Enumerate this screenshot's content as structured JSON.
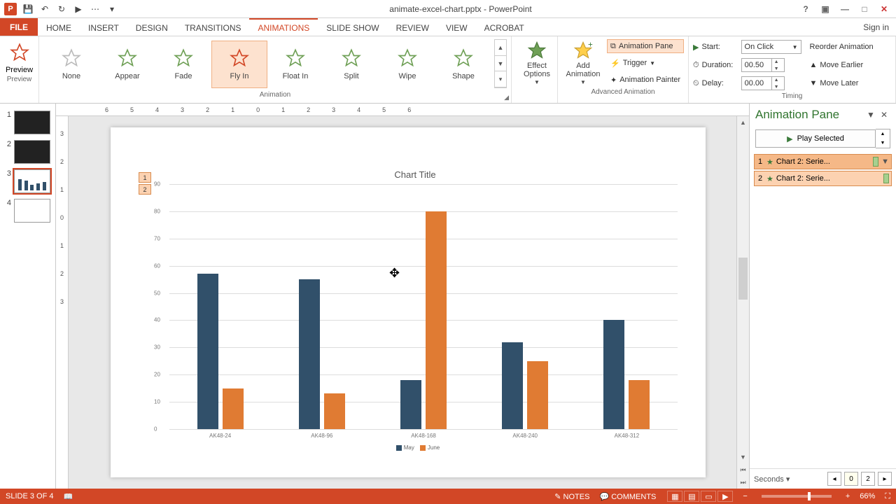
{
  "title": "animate-excel-chart.pptx - PowerPoint",
  "signin": "Sign in",
  "tabs": {
    "file": "FILE",
    "items": [
      "HOME",
      "INSERT",
      "DESIGN",
      "TRANSITIONS",
      "ANIMATIONS",
      "SLIDE SHOW",
      "REVIEW",
      "VIEW",
      "ACROBAT"
    ],
    "active": "ANIMATIONS"
  },
  "ribbon": {
    "preview": "Preview",
    "preview_group": "Preview",
    "gallery": [
      "None",
      "Appear",
      "Fade",
      "Fly In",
      "Float In",
      "Split",
      "Wipe",
      "Shape"
    ],
    "gallery_selected": "Fly In",
    "animation_group": "Animation",
    "effect_options": "Effect Options",
    "add_animation": "Add Animation",
    "animation_pane": "Animation Pane",
    "trigger": "Trigger",
    "animation_painter": "Animation Painter",
    "advanced_group": "Advanced Animation",
    "start_label": "Start:",
    "start_value": "On Click",
    "duration_label": "Duration:",
    "duration_value": "00.50",
    "delay_label": "Delay:",
    "delay_value": "00.00",
    "reorder": "Reorder Animation",
    "move_earlier": "Move Earlier",
    "move_later": "Move Later",
    "timing_group": "Timing"
  },
  "ruler_h": [
    "6",
    "5",
    "4",
    "3",
    "2",
    "1",
    "0",
    "1",
    "2",
    "3",
    "4",
    "5",
    "6"
  ],
  "ruler_v": [
    "3",
    "2",
    "1",
    "0",
    "1",
    "2",
    "3"
  ],
  "slide_tags": [
    "1",
    "2"
  ],
  "anim_pane": {
    "title": "Animation Pane",
    "play": "Play Selected",
    "items": [
      {
        "n": "1",
        "label": "Chart 2: Serie..."
      },
      {
        "n": "2",
        "label": "Chart 2: Serie..."
      }
    ],
    "seconds": "Seconds",
    "t0": "0",
    "t1": "2"
  },
  "status": {
    "slide": "SLIDE 3 OF 4",
    "notes": "NOTES",
    "comments": "COMMENTS",
    "zoom": "66%"
  },
  "chart_data": {
    "type": "bar",
    "title": "Chart Title",
    "categories": [
      "AK48-24",
      "AK48-96",
      "AK48-168",
      "AK48-240",
      "AK48-312"
    ],
    "series": [
      {
        "name": "May",
        "color": "#31506a",
        "values": [
          57,
          55,
          18,
          32,
          40
        ]
      },
      {
        "name": "June",
        "color": "#e07b33",
        "values": [
          15,
          13,
          80,
          25,
          18
        ]
      }
    ],
    "yticks": [
      0,
      10,
      20,
      30,
      40,
      50,
      60,
      70,
      80,
      90
    ],
    "ymax": 90
  }
}
